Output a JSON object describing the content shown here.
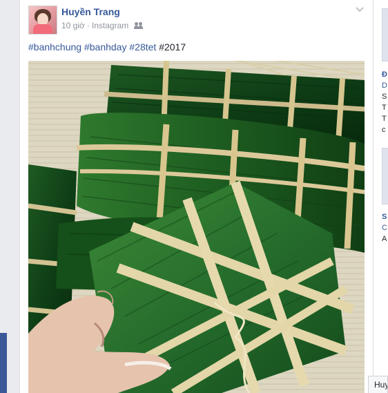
{
  "post": {
    "author": "Huyền Trang",
    "time": "10 giờ",
    "separator": "·",
    "source": "Instagram",
    "audience_icon": "friends-icon",
    "menu_icon": "chevron-down-icon",
    "hashtags": [
      "#banhchung",
      "#banhday",
      "#28tet"
    ],
    "year_tag": "#2017",
    "photo_subject": "banh-chung"
  },
  "sidebar": {
    "lines": [
      "Đ",
      "D",
      "S",
      "T",
      "T",
      "c",
      "S",
      "C",
      "A"
    ]
  },
  "chat": {
    "tab_label": "Huy"
  },
  "colors": {
    "link": "#365899",
    "background": "#e9ebee",
    "accent": "#3b5998"
  }
}
